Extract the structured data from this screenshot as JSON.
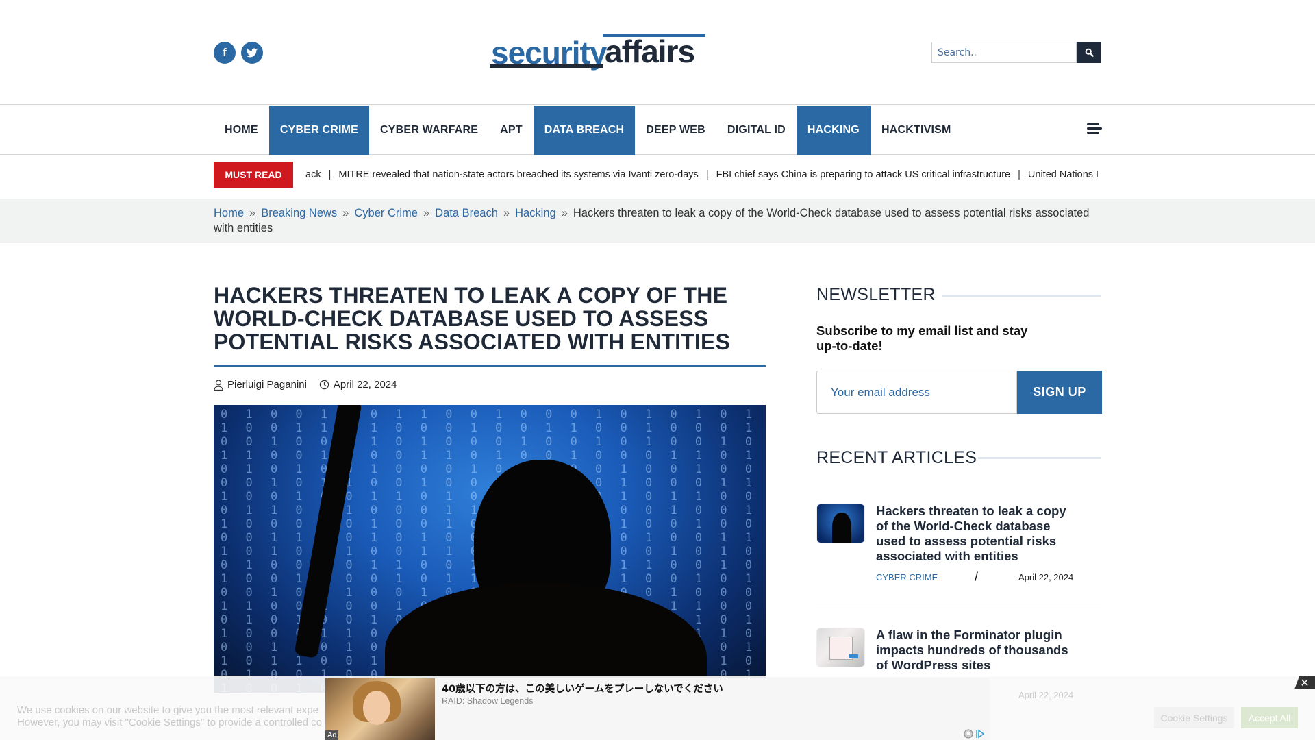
{
  "header": {
    "social": [
      {
        "name": "facebook",
        "glyph": "f"
      },
      {
        "name": "twitter",
        "glyph": "t"
      }
    ],
    "logo": {
      "part1": "security",
      "part2": "affairs"
    },
    "search": {
      "placeholder": "Search..",
      "button_icon": "search-icon"
    }
  },
  "nav": {
    "items": [
      {
        "label": "HOME",
        "active": false
      },
      {
        "label": "CYBER CRIME",
        "active": true
      },
      {
        "label": "CYBER WARFARE",
        "active": false
      },
      {
        "label": "APT",
        "active": false
      },
      {
        "label": "DATA BREACH",
        "active": true
      },
      {
        "label": "DEEP WEB",
        "active": false
      },
      {
        "label": "DIGITAL ID",
        "active": false
      },
      {
        "label": "HACKING",
        "active": true
      },
      {
        "label": "HACKTIVISM",
        "active": false
      }
    ],
    "menu_icon": "hamburger-icon"
  },
  "ticker": {
    "label": "MUST READ",
    "items": [
      "ack",
      "MITRE revealed that nation-state actors breached its systems via Ivanti zero-days",
      "FBI chief says China is preparing to attack US critical infrastructure",
      "United Nations I"
    ]
  },
  "breadcrumb": {
    "links": [
      "Home",
      "Breaking News",
      "Cyber Crime",
      "Data Breach",
      "Hacking"
    ],
    "current": "Hackers threaten to leak a copy of the World-Check database used to assess potential risks associated with entities"
  },
  "article": {
    "title": "Hackers threaten to leak a copy of the World-Check database used to assess potential risks associated with entities",
    "author": "Pierluigi Paganini",
    "date": "April 22, 2024"
  },
  "sidebar": {
    "newsletter": {
      "heading": "NEWSLETTER",
      "subtitle": "Subscribe to my email list and stay up-to-date!",
      "email_placeholder": "Your email address",
      "button": "SIGN UP"
    },
    "recent": {
      "heading": "RECENT ARTICLES",
      "items": [
        {
          "title": "Hackers threaten to leak a copy of the World-Check database used to assess potential risks associated with entities",
          "category": "CYBER CRIME",
          "separator": "/",
          "date": "April 22, 2024"
        },
        {
          "title": "A flaw in the Forminator plugin impacts hundreds of thousands of WordPress sites",
          "category": "",
          "separator": "",
          "date": "April 22, 2024"
        }
      ]
    }
  },
  "cookie": {
    "text_line1": "We use cookies on our website to give you the most relevant expe",
    "text_line2": "However, you may visit \"Cookie Settings\" to provide a controlled co",
    "settings_button": "Cookie Settings",
    "accept_button": "Accept All",
    "close": "✕"
  },
  "ad": {
    "headline": "40歳以下の方は、この美しいゲームをプレーしないでください",
    "advertiser": "RAID: Shadow Legends",
    "badge": "Ad"
  },
  "colors": {
    "brand_blue": "#2b69a5",
    "must_read_red": "#d0181f",
    "dark": "#1f2937"
  }
}
